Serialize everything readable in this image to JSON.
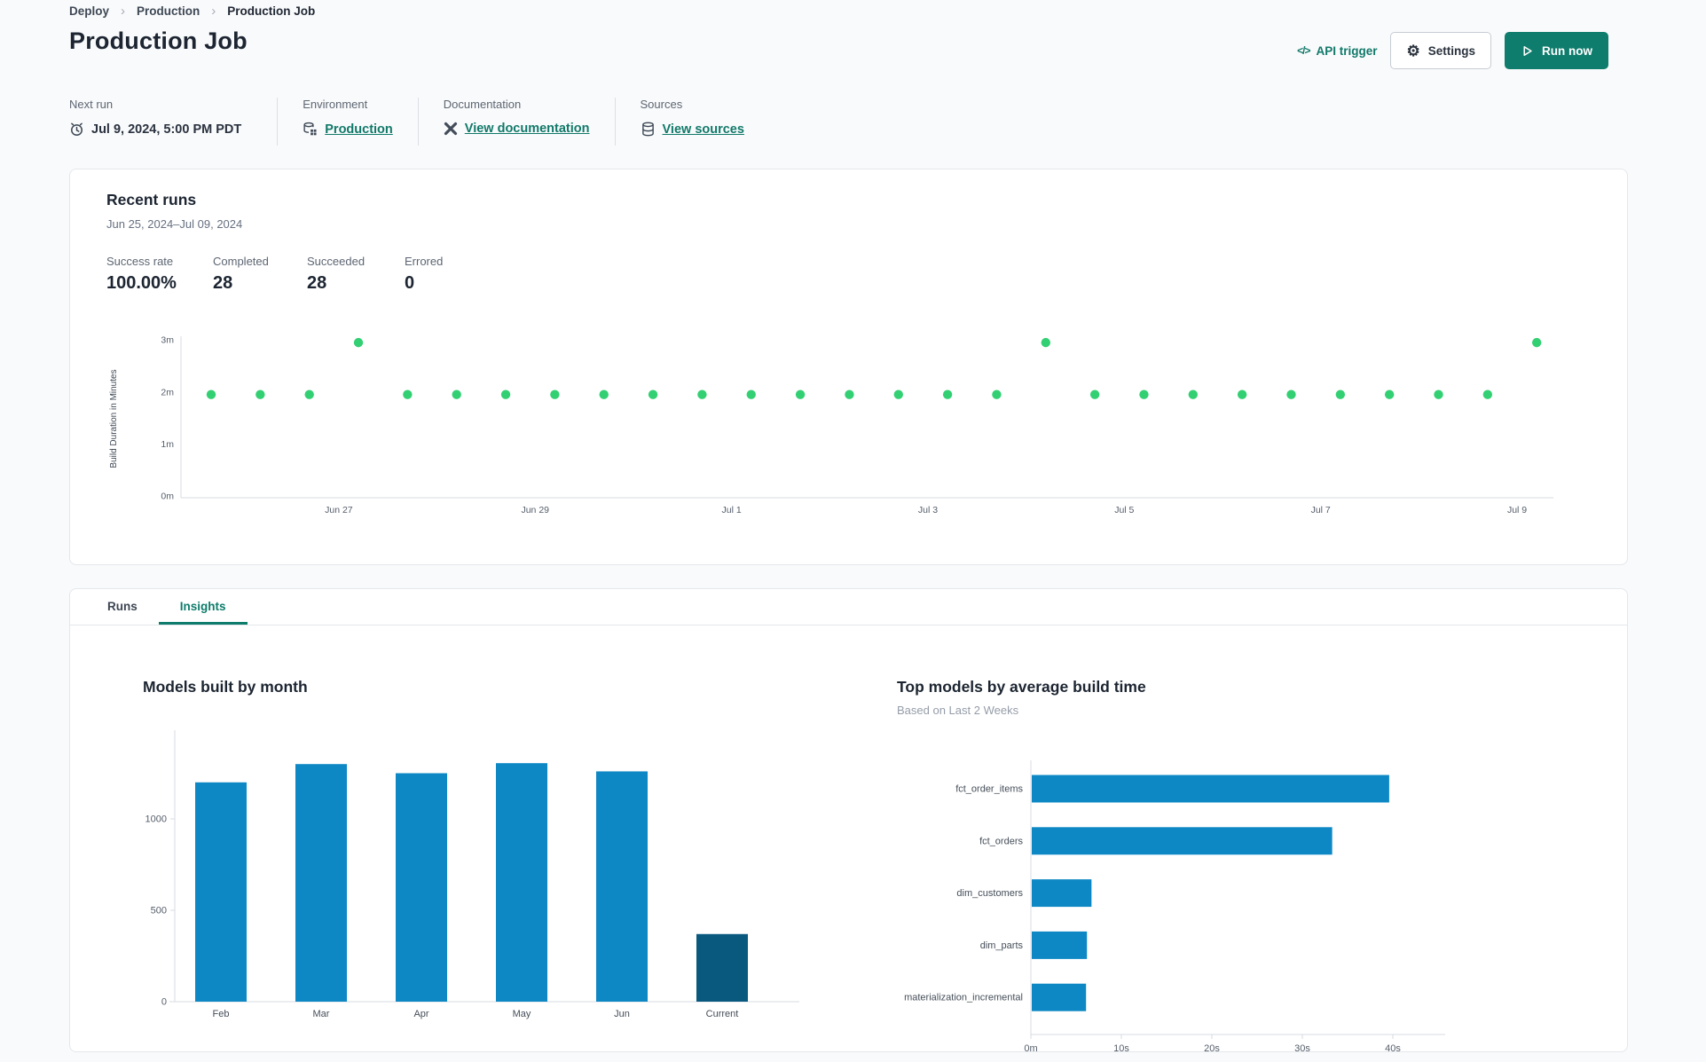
{
  "breadcrumb": {
    "items": [
      "Deploy",
      "Production",
      "Production Job"
    ]
  },
  "header": {
    "title": "Production Job",
    "api_trigger_label": "API trigger",
    "api_trigger_glyph": "</>",
    "settings_label": "Settings",
    "settings_glyph": "⚙",
    "run_now_label": "Run now"
  },
  "info": {
    "columns": [
      {
        "label": "Next run",
        "value": "Jul 9, 2024, 5:00 PM PDT",
        "icon": "clock-icon"
      },
      {
        "label": "Environment",
        "value": "Production",
        "icon": "environment-icon"
      },
      {
        "label": "Documentation",
        "value": "View documentation",
        "icon": "dbt-logo-icon"
      },
      {
        "label": "Sources",
        "value": "View sources",
        "icon": "database-icon"
      }
    ]
  },
  "recent_runs": {
    "title": "Recent runs",
    "date_range": "Jun 25, 2024–Jul 09, 2024",
    "stats": [
      {
        "label": "Success rate",
        "value": "100.00%"
      },
      {
        "label": "Completed",
        "value": "28"
      },
      {
        "label": "Succeeded",
        "value": "28"
      },
      {
        "label": "Errored",
        "value": "0"
      }
    ]
  },
  "tabs": [
    {
      "label": "Runs",
      "active": false
    },
    {
      "label": "Insights",
      "active": true
    }
  ],
  "colors": {
    "accent_teal": "#0e7d6d",
    "link_teal": "#11796a",
    "run_dot_green": "#33d073",
    "bar_blue": "#0e88c4",
    "bar_dark": "#09597e"
  },
  "chart_data": [
    {
      "name": "recent_runs_build_duration",
      "type": "scatter",
      "ylabel": "Build Duration in Minutes",
      "y_ticks": [
        "0m",
        "1m",
        "2m",
        "3m"
      ],
      "ylim": [
        0,
        3.1
      ],
      "x_ticks": [
        {
          "label": "Jun 27",
          "at": 2.6
        },
        {
          "label": "Jun 29",
          "at": 6.6
        },
        {
          "label": "Jul 1",
          "at": 10.6
        },
        {
          "label": "Jul 3",
          "at": 14.6
        },
        {
          "label": "Jul 5",
          "at": 18.6
        },
        {
          "label": "Jul 7",
          "at": 22.6
        },
        {
          "label": "Jul 9",
          "at": 26.6
        }
      ],
      "point_color": "#33d073",
      "values": [
        1.95,
        1.95,
        1.95,
        2.95,
        1.95,
        1.95,
        1.95,
        1.95,
        1.95,
        1.95,
        1.95,
        1.95,
        1.95,
        1.95,
        1.95,
        1.95,
        1.95,
        2.95,
        1.95,
        1.95,
        1.95,
        1.95,
        1.95,
        1.95,
        1.95,
        1.95,
        1.95,
        2.95
      ]
    },
    {
      "name": "models_built_by_month",
      "type": "bar",
      "title": "Models built by month",
      "categories": [
        "Feb",
        "Mar",
        "Apr",
        "May",
        "Jun",
        "Current"
      ],
      "values": [
        1200,
        1300,
        1250,
        1305,
        1260,
        370
      ],
      "y_ticks": [
        0,
        500,
        1000
      ],
      "ylim": [
        0,
        1450
      ],
      "bar_color": "#0e88c4",
      "highlight_color": "#09597e",
      "highlight_index": 5
    },
    {
      "name": "top_models_by_average_build_time",
      "type": "bar-horizontal",
      "title": "Top models by average build time",
      "subtitle": "Based on Last 2 Weeks",
      "categories": [
        "fct_order_items",
        "fct_orders",
        "dim_customers",
        "dim_parts",
        "materialization_incremental"
      ],
      "values_seconds": [
        39.5,
        33.2,
        6.6,
        6.1,
        6.0
      ],
      "x_ticks": [
        {
          "label": "0m",
          "at": 0
        },
        {
          "label": "10s",
          "at": 10
        },
        {
          "label": "20s",
          "at": 20
        },
        {
          "label": "30s",
          "at": 30
        },
        {
          "label": "40s",
          "at": 40
        }
      ],
      "xlim": [
        0,
        45
      ],
      "bar_color": "#0e88c4"
    }
  ]
}
